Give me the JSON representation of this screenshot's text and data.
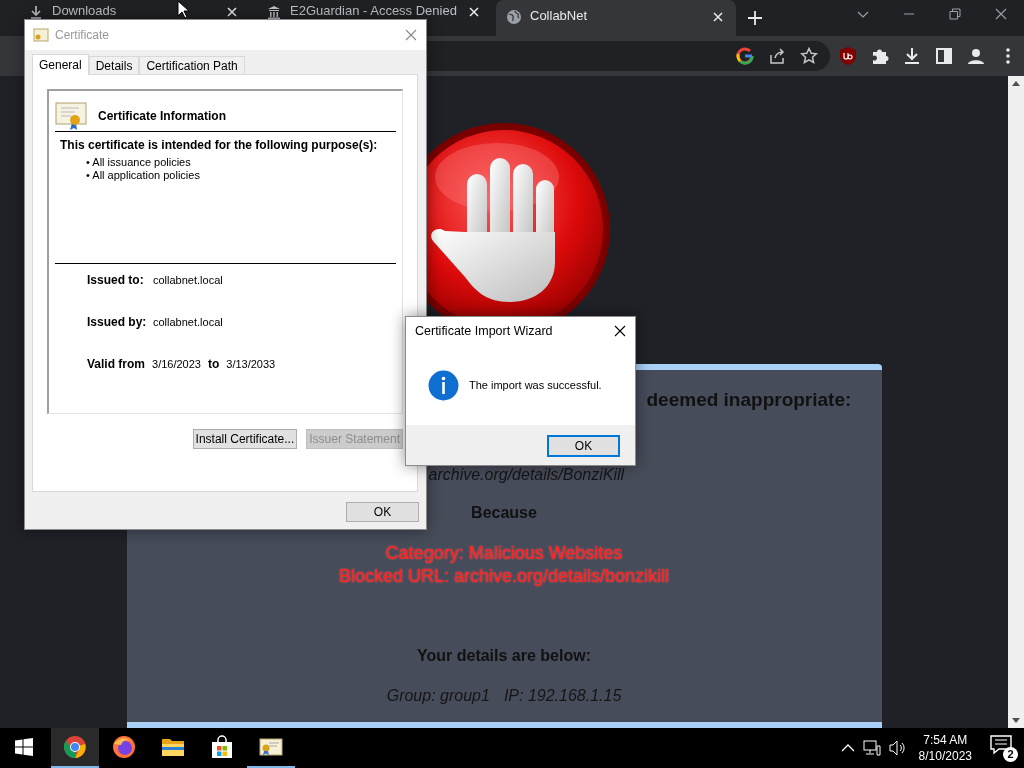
{
  "browser": {
    "tabs": [
      {
        "title": "Downloads",
        "kind": "download",
        "selected": false
      },
      {
        "title": "E2Guardian - Access Denied",
        "kind": "bank",
        "selected": false
      },
      {
        "title": "CollabNet",
        "kind": "globe",
        "selected": true
      }
    ]
  },
  "page": {
    "heading": "deemed inappropriate:",
    "url": "archive.org/details/BonziKill",
    "because": "Because",
    "reasons": [
      "Category: Malicious Websites",
      "Blocked URL: archive.org/details/bonzikill"
    ],
    "details_heading": "Your details are below:",
    "group": "Group: group1",
    "ip": "IP: 192.168.1.15"
  },
  "certificate_dialog": {
    "title": "Certificate",
    "tabs": [
      {
        "label": "General",
        "selected": true
      },
      {
        "label": "Details",
        "selected": false
      },
      {
        "label": "Certification Path",
        "selected": false
      }
    ],
    "info_title": "Certificate Information",
    "purpose_heading": "This certificate is intended for the following purpose(s):",
    "purposes": [
      "• All issuance policies",
      "• All application policies"
    ],
    "fields": [
      {
        "label": "Issued to:",
        "value": "collabnet.local"
      },
      {
        "label": "Issued by:",
        "value": "collabnet.local"
      }
    ],
    "validity": {
      "from_label": "Valid from",
      "from": "3/16/2023",
      "to_label": "to",
      "to": "3/13/2033"
    },
    "buttons": [
      {
        "label": "Install Certificate...",
        "disabled": false
      },
      {
        "label": "Issuer Statement",
        "disabled": true
      }
    ],
    "ok": "OK"
  },
  "import_dialog": {
    "title": "Certificate Import Wizard",
    "message": "The import was successful.",
    "ok": "OK"
  },
  "taskbar": {
    "apps": [
      {
        "kind": "chrome",
        "selected": true,
        "running": true
      },
      {
        "kind": "firefox",
        "selected": false,
        "running": false
      },
      {
        "kind": "explorer",
        "selected": false,
        "running": false
      },
      {
        "kind": "store",
        "selected": false,
        "running": false
      },
      {
        "kind": "certificate",
        "selected": false,
        "running": true
      }
    ],
    "time": "7:54 AM",
    "date": "8/10/2023",
    "notifications": "2"
  }
}
